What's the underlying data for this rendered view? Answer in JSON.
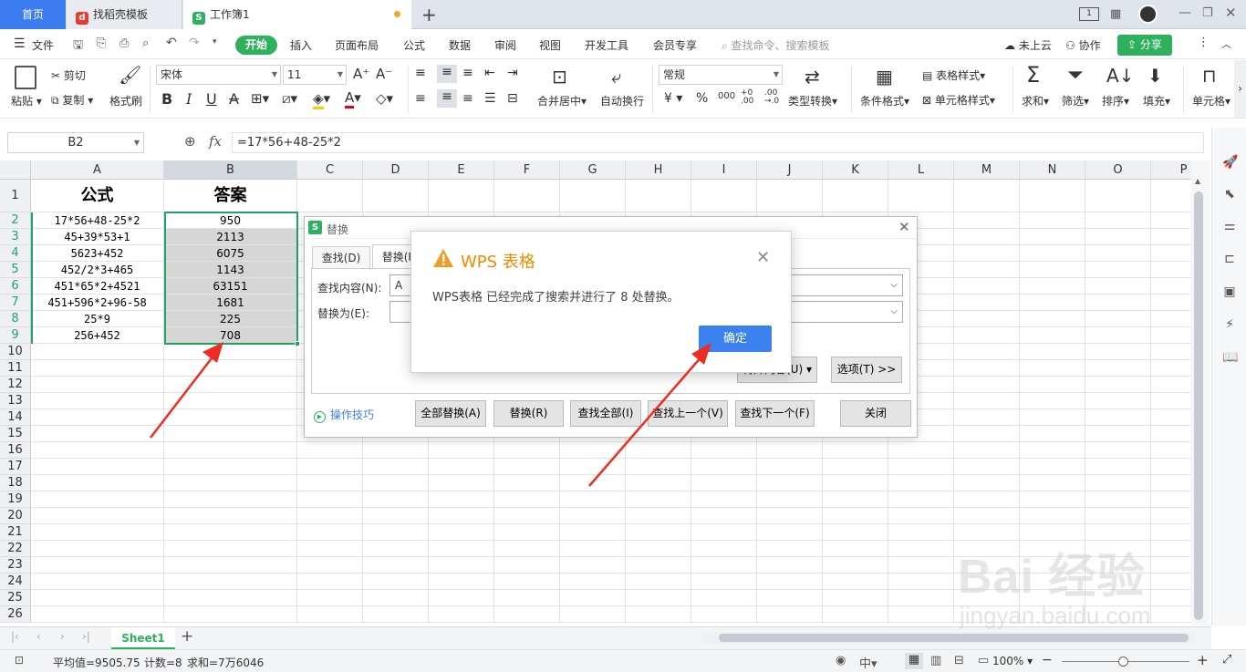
{
  "tabs": {
    "home": "首页",
    "template": "找稻壳模板",
    "workbook": "工作簿1",
    "new_tab": "+"
  },
  "menu": {
    "file": "文件",
    "items": [
      "开始",
      "插入",
      "页面布局",
      "公式",
      "数据",
      "审阅",
      "视图",
      "开发工具",
      "会员专享"
    ],
    "search_placeholder": "查找命令、搜索模板",
    "cloud": "未上云",
    "collab": "协作",
    "share": "分享"
  },
  "ribbon": {
    "paste": "粘贴",
    "cut": "剪切",
    "copy": "复制",
    "format_painter": "格式刷",
    "font_name": "宋体",
    "font_size": "11",
    "merge_center": "合并居中",
    "wrap": "自动换行",
    "number_format": "常规",
    "convert": "类型转换",
    "cond_format": "条件格式",
    "table_style": "表格样式",
    "cell_style": "单元格样式",
    "sum": "求和",
    "filter": "筛选",
    "sort": "排序",
    "fill": "填充",
    "cells": "单元格"
  },
  "formula_bar": {
    "name_box": "B2",
    "fx": "fx",
    "formula": "=17*56+48-25*2"
  },
  "columns": [
    "A",
    "B",
    "C",
    "D",
    "E",
    "F",
    "G",
    "H",
    "I",
    "J",
    "K",
    "L",
    "M",
    "N",
    "O",
    "P"
  ],
  "rows": [
    "1",
    "2",
    "3",
    "4",
    "5",
    "6",
    "7",
    "8",
    "9",
    "10",
    "11",
    "12",
    "13",
    "14",
    "15",
    "16",
    "17",
    "18",
    "19",
    "20",
    "21",
    "22",
    "23",
    "24",
    "25",
    "26"
  ],
  "table": {
    "header_a": "公式",
    "header_b": "答案",
    "formulas": [
      "17*56+48-25*2",
      "45+39*53+1",
      "5623+452",
      "452/2*3+465",
      "451*65*2+4521",
      "451+596*2+96-58",
      "25*9",
      "256+452"
    ],
    "answers": [
      "950",
      "2113",
      "6075",
      "1143",
      "63151",
      "1681",
      "225",
      "708"
    ]
  },
  "replace_dialog": {
    "title": "替换",
    "tab_find": "查找(D)",
    "tab_replace": "替换(P)",
    "find_label": "查找内容(N):",
    "find_value": "A",
    "replace_label": "替换为(E):",
    "replace_value": "",
    "special_label": "特殊内容(U) ▾",
    "options": "选项(T) >>",
    "tips": "操作技巧",
    "btn_replace_all": "全部替换(A)",
    "btn_replace": "替换(R)",
    "btn_find_all": "查找全部(I)",
    "btn_find_prev": "查找上一个(V)",
    "btn_find_next": "查找下一个(F)",
    "btn_close": "关闭"
  },
  "alert": {
    "title": "WPS 表格",
    "message": "WPS表格 已经完成了搜索并进行了 8 处替换。",
    "ok": "确定"
  },
  "sheet_tab": "Sheet1",
  "status": {
    "average": "平均值=9505.75",
    "count": "计数=8",
    "sum": "求和=7万6046",
    "zoom": "100%"
  },
  "watermark": {
    "brand": "Bai 经验",
    "url": "jingyan.baidu.com"
  },
  "colors": {
    "accent_blue": "#3b7cf0",
    "green": "#2fb05d",
    "warning_orange": "#f59a23",
    "selection_green": "#21a366",
    "arrow_red": "#ee2c1f"
  }
}
